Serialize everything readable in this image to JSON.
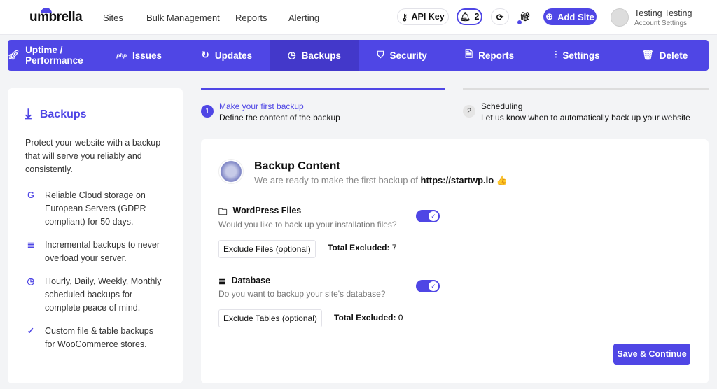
{
  "header": {
    "logo": "umbrella",
    "nav": [
      "Sites",
      "Bulk Management",
      "Reports",
      "Alerting"
    ],
    "api_key": "API Key",
    "notifications": "2",
    "add_site": "Add Site",
    "user_name": "Testing Testing",
    "account_settings": "Account Settings"
  },
  "tabs": [
    {
      "label": "Uptime / Performance",
      "icon": "rocket-icon"
    },
    {
      "label": "Issues",
      "icon": "php"
    },
    {
      "label": "Updates",
      "icon": "refresh-icon"
    },
    {
      "label": "Backups",
      "icon": "history-icon",
      "active": true
    },
    {
      "label": "Security",
      "icon": "shield-icon"
    },
    {
      "label": "Reports",
      "icon": "file-icon"
    },
    {
      "label": "Settings",
      "icon": "sliders-icon"
    },
    {
      "label": "Delete",
      "icon": "trash-icon"
    }
  ],
  "sidebar": {
    "title": "Backups",
    "intro": "Protect your website with a backup that will serve you reliably and consistently.",
    "features": [
      {
        "icon": "google-icon",
        "text": "Reliable Cloud storage on European Servers (GDPR compliant) for 50 days."
      },
      {
        "icon": "database-icon",
        "text": "Incremental backups to never overload your server."
      },
      {
        "icon": "clock-icon",
        "text": "Hourly, Daily, Weekly, Monthly scheduled backups for complete peace of mind."
      },
      {
        "icon": "check-icon",
        "text": "Custom file & table backups for WooCommerce stores."
      }
    ]
  },
  "steps": [
    {
      "num": "1",
      "title": "Make your first backup",
      "desc": "Define the content of the backup",
      "active": true
    },
    {
      "num": "2",
      "title": "Scheduling",
      "desc": "Let us know when to automatically back up your website",
      "active": false
    }
  ],
  "content": {
    "title": "Backup Content",
    "subtitle": "We are ready to make the first backup of",
    "site": "https://startwp.io",
    "emoji": "👍",
    "files": {
      "title": "WordPress Files",
      "desc": "Would you like to back up your installation files?",
      "enabled": true,
      "button": "Exclude Files (optional)",
      "excluded_label": "Total Excluded:",
      "excluded": "7"
    },
    "database": {
      "title": "Database",
      "desc": "Do you want to backup your site's database?",
      "enabled": true,
      "button": "Exclude Tables (optional)",
      "excluded_label": "Total Excluded:",
      "excluded": "0"
    },
    "save": "Save & Continue"
  },
  "colors": {
    "accent": "#4f46e5",
    "active_tab": "#4338ca"
  }
}
